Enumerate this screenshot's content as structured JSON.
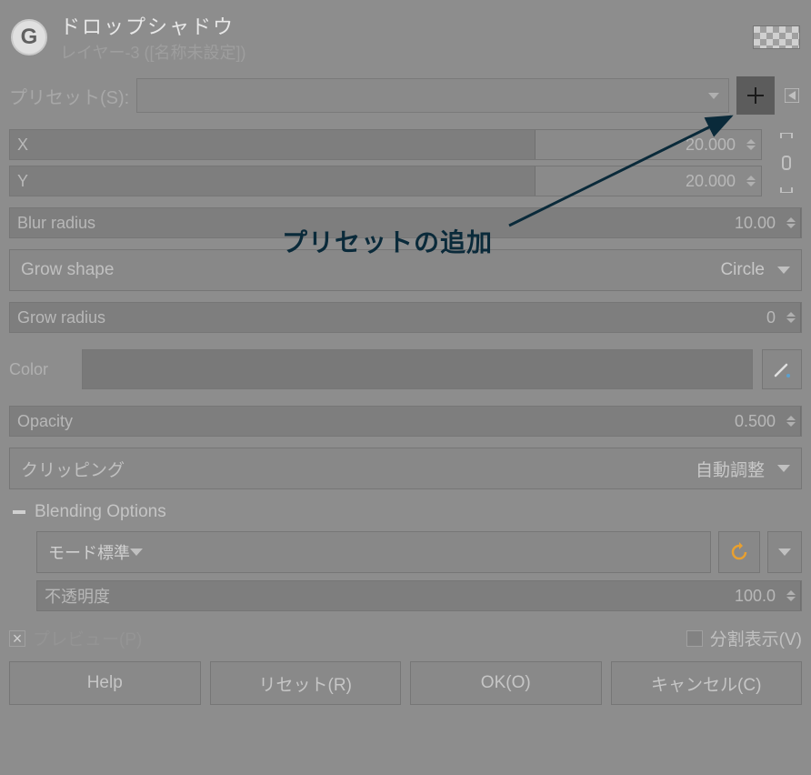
{
  "header": {
    "title": "ドロップシャドウ",
    "subtitle_layer": "レイヤー-3",
    "subtitle_suffix": " ([名称未設定])",
    "app_icon_letter": "G"
  },
  "preset": {
    "label": "プリセット(S):",
    "value": ""
  },
  "params": {
    "x": {
      "label": "X",
      "value": "20.000",
      "fill_pct": 70
    },
    "y": {
      "label": "Y",
      "value": "20.000",
      "fill_pct": 70
    },
    "blur": {
      "label": "Blur radius",
      "value": "10.00",
      "fill_pct": 100
    },
    "grow_shape": {
      "label": "Grow shape",
      "value": "Circle"
    },
    "grow_radius": {
      "label": "Grow radius",
      "value": "0",
      "fill_pct": 100
    },
    "color": {
      "label": "Color"
    },
    "opacity": {
      "label": "Opacity",
      "value": "0.500",
      "fill_pct": 100
    },
    "clipping": {
      "label": "クリッピング",
      "value": "自動調整"
    }
  },
  "blending": {
    "section_label": "Blending Options",
    "mode": {
      "label": "モード",
      "value": "標準"
    },
    "opacity": {
      "label": "不透明度",
      "value": "100.0",
      "fill_pct": 100
    }
  },
  "footer": {
    "preview": "プレビュー(P)",
    "split": "分割表示(V)"
  },
  "buttons": {
    "help": "Help",
    "reset": "リセット(R)",
    "ok": "OK(O)",
    "cancel": "キャンセル(C)"
  },
  "annotation": {
    "text": "プリセットの追加"
  },
  "icons": {
    "plus": "+",
    "link": "⊏⊐"
  }
}
